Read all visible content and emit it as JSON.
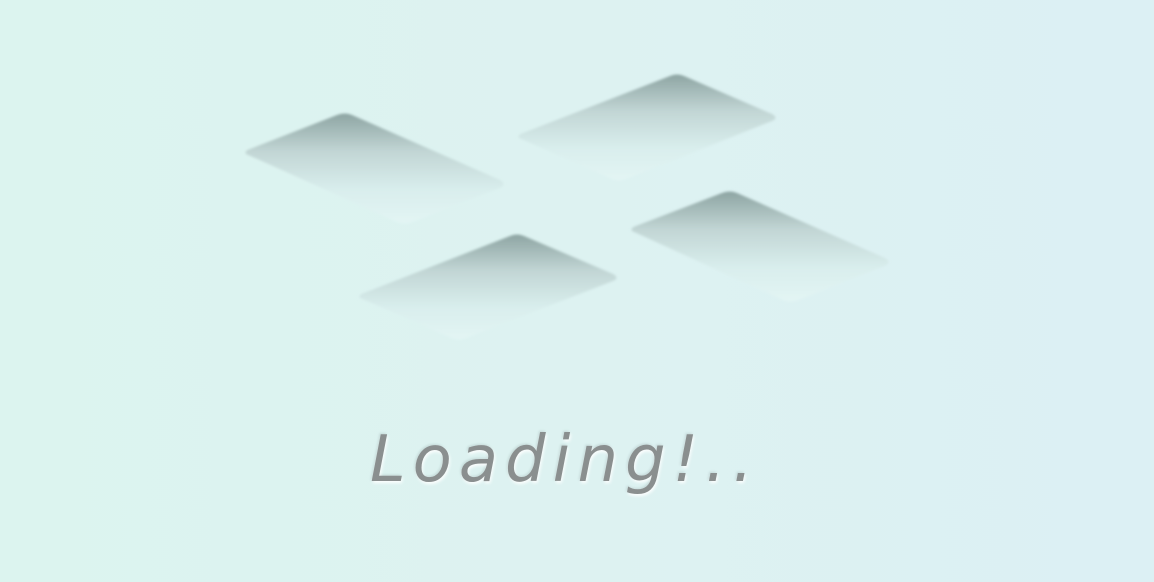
{
  "loader": {
    "text": "Loading!..",
    "tile_count": 4
  },
  "colors": {
    "background_start": "#dcf4ef",
    "background_end": "#dcf0f4",
    "tile_shade": "#8fa8a6",
    "tile_face": "#dff3f2",
    "text": "#8a8f8f"
  }
}
